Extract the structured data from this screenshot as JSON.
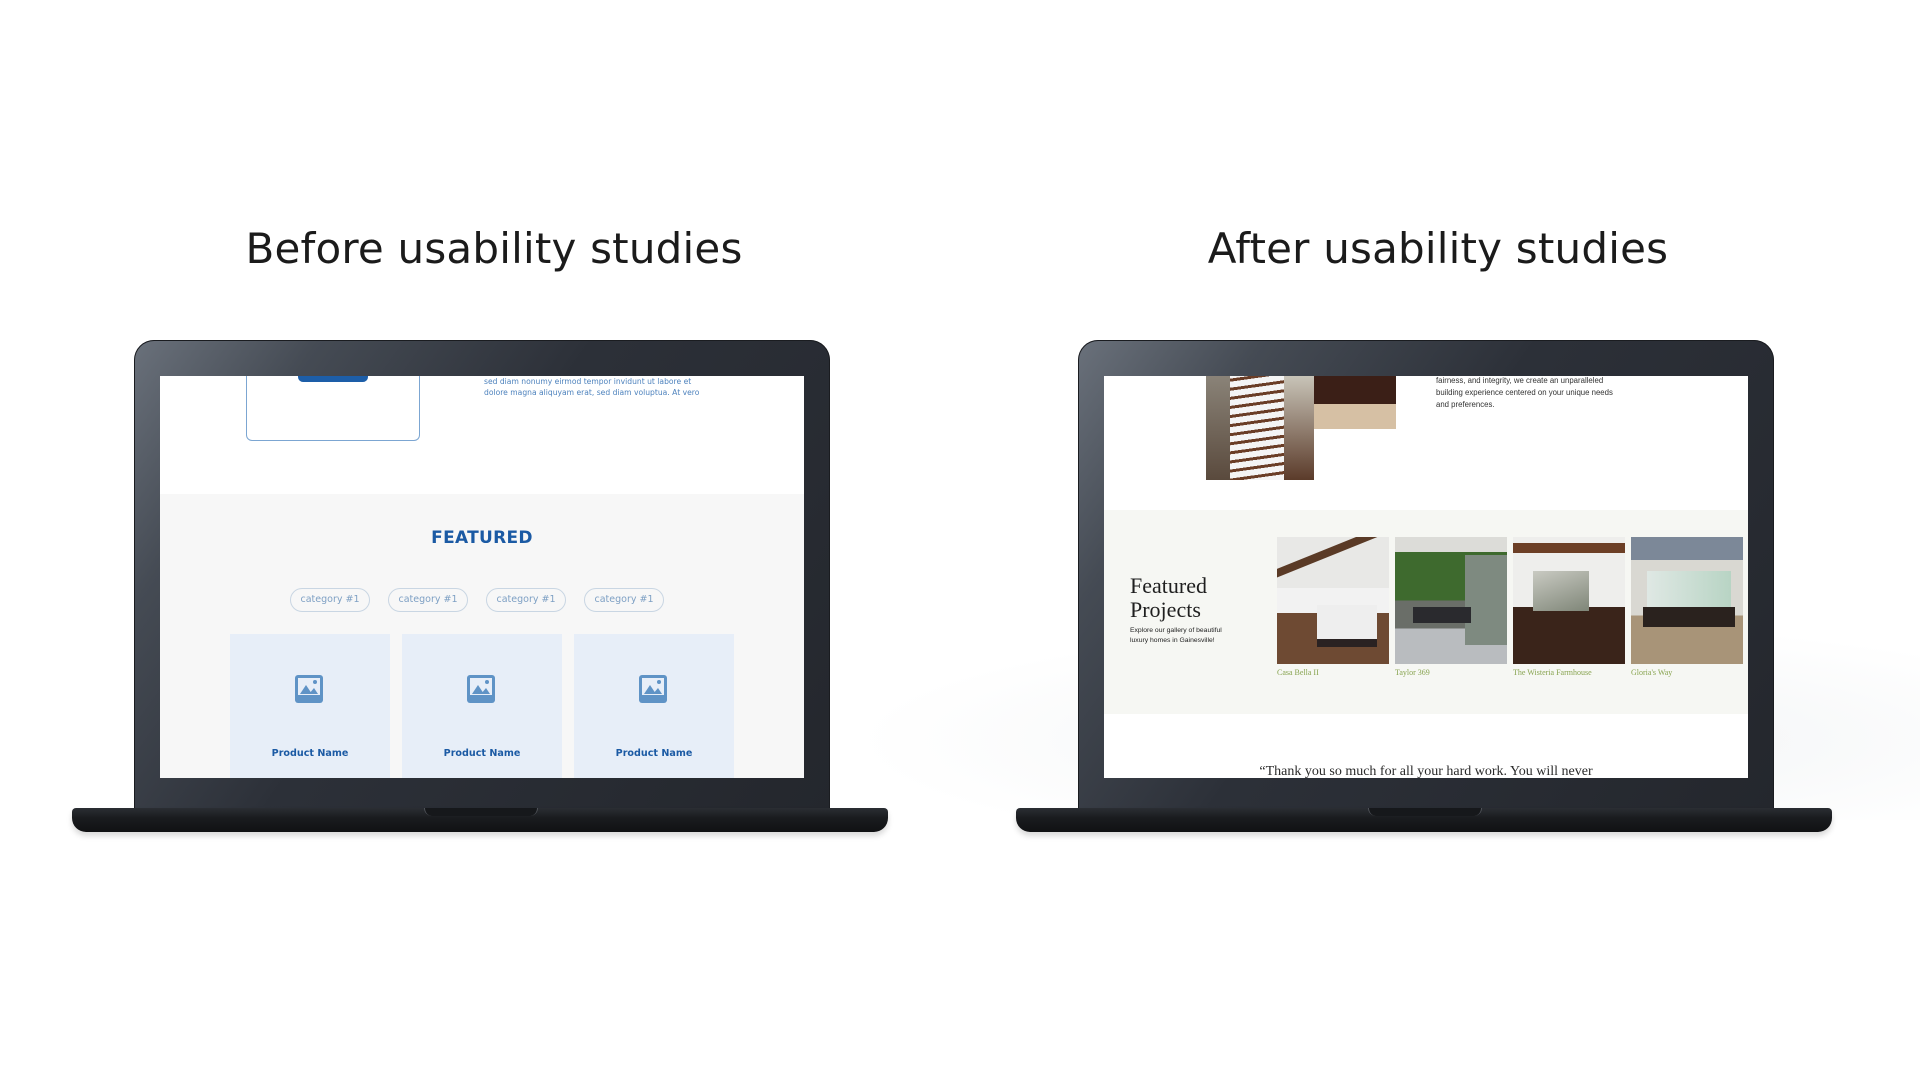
{
  "slide": {
    "before_title": "Before usability studies",
    "after_title": "After usability studies"
  },
  "before_screen": {
    "lorem_lines": [
      "sed diam nonumy eirmod tempor invidunt ut labore et",
      "dolore magna aliquyam erat, sed diam voluptua. At vero"
    ],
    "featured_heading": "FEATURED",
    "categories": [
      "category #1",
      "category #1",
      "category #1",
      "category #1"
    ],
    "products": [
      {
        "name": "Product Name",
        "icon": "image-placeholder-icon"
      },
      {
        "name": "Product Name",
        "icon": "image-placeholder-icon"
      },
      {
        "name": "Product Name",
        "icon": "image-placeholder-icon"
      }
    ],
    "colors": {
      "brand_blue": "#1b5aa4",
      "card_bg": "#e7eef8",
      "section_bg": "#f7f7f7"
    }
  },
  "after_screen": {
    "intro_lines": [
      "fairness, and integrity, we create an unparalleled",
      "building experience centered on your unique needs",
      "and preferences."
    ],
    "featured_heading_line1": "Featured",
    "featured_heading_line2": "Projects",
    "featured_sub": "Explore our gallery of beautiful luxury homes in Gainesville!",
    "projects": [
      {
        "name": "Casa Bella II"
      },
      {
        "name": "Taylor 369"
      },
      {
        "name": "The Wisteria Farmhouse"
      },
      {
        "name": "Gloria's Way"
      }
    ],
    "testimonial_partial": "“Thank you so much for all your hard work. You will never",
    "colors": {
      "accent_green": "#88a450",
      "section_bg": "#f6f7f3"
    }
  }
}
